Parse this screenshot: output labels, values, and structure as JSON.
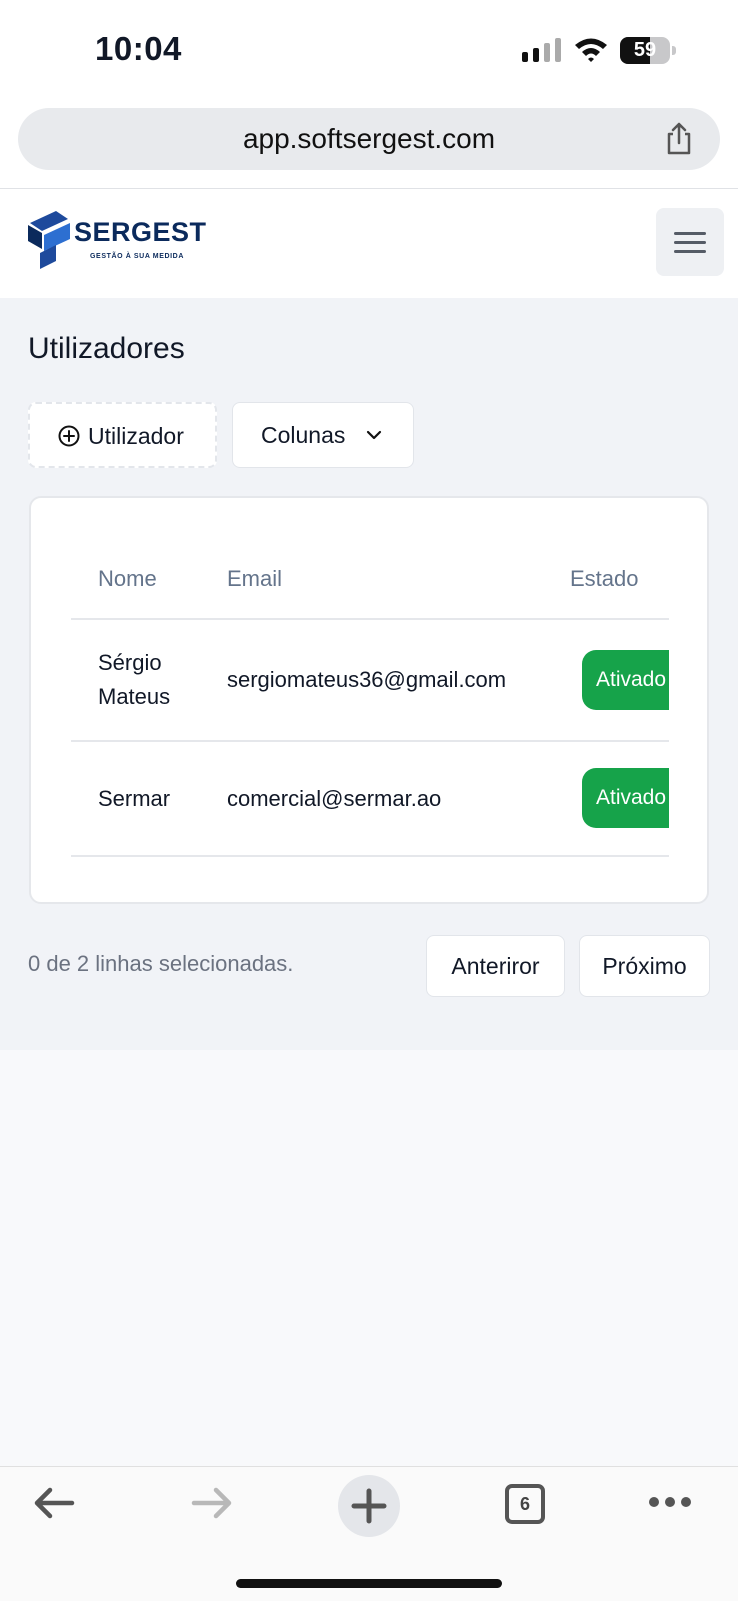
{
  "status": {
    "time": "10:04",
    "battery": "59",
    "battery_level": 0.59
  },
  "browser": {
    "url": "app.softsergest.com",
    "tab_count": "6"
  },
  "brand": {
    "name": "SERGEST",
    "tagline": "GESTÃO À SUA MEDIDA",
    "color": "#0b2a5c"
  },
  "page": {
    "title": "Utilizadores",
    "add_button": "Utilizador",
    "columns_button": "Colunas"
  },
  "table": {
    "headers": {
      "name": "Nome",
      "email": "Email",
      "status": "Estado"
    },
    "rows": [
      {
        "name_line1": "Sérgio",
        "name_line2": "Mateus",
        "email": "sergiomateus36@gmail.com",
        "status": "Ativado"
      },
      {
        "name": "Sermar",
        "email": "comercial@sermar.ao",
        "status": "Ativado"
      }
    ],
    "status_color": "#16a34a"
  },
  "pagination": {
    "selection_text": "0 de 2 linhas selecionadas.",
    "prev_label": "Anteriror",
    "next_label": "Próximo"
  }
}
